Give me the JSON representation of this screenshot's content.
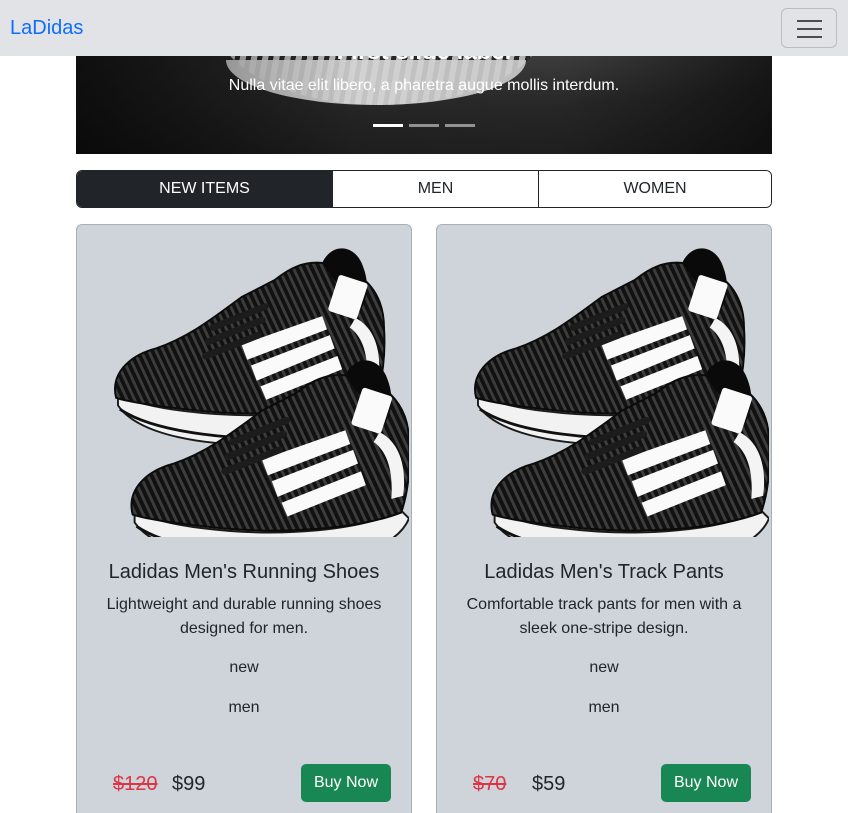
{
  "navbar": {
    "brand": "LaDidas"
  },
  "carousel": {
    "title": "First slide label",
    "caption": "Nulla vitae elit libero, a pharetra augue mollis interdum.",
    "slide_count": 3,
    "active_slide": 1
  },
  "tabs": [
    {
      "label": "New Items",
      "active": true
    },
    {
      "label": "Men",
      "active": false
    },
    {
      "label": "Women",
      "active": false
    }
  ],
  "products": [
    {
      "title": "Ladidas Men's Running Shoes",
      "description": "Lightweight and durable running shoes designed for men.",
      "tag": "new",
      "category": "men",
      "old_price": "$120",
      "price": "$99",
      "button": "Buy Now"
    },
    {
      "title": "Ladidas Men's Track Pants",
      "description": "Comfortable track pants for men with a sleek one-stripe design.",
      "tag": "new",
      "category": "men",
      "old_price": "$70",
      "price": "$59",
      "button": "Buy Now"
    }
  ],
  "colors": {
    "brand": "#0d6efd",
    "navbar_bg": "#e1e3e6",
    "active_tab": "#212529",
    "card_bg": "#ced4da",
    "old_price": "#dc3545",
    "buy_button": "#198754"
  }
}
